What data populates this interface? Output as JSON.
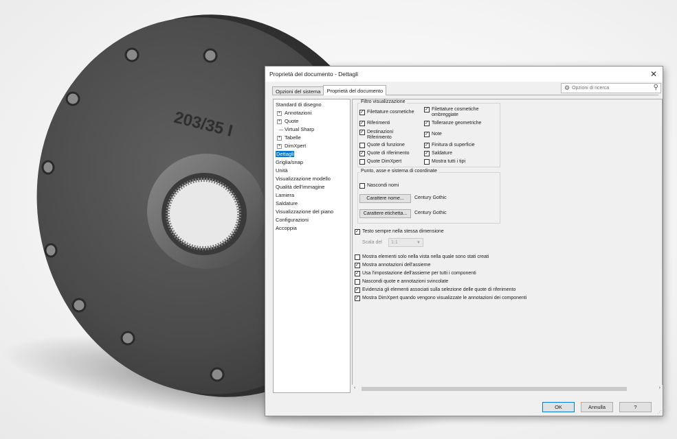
{
  "viewport": {
    "part_engraving": "203/35 I"
  },
  "dialog": {
    "title": "Proprietà del documento - Dettagli",
    "close_icon": "close-icon",
    "tabs": [
      {
        "label": "Opzioni del sistema",
        "active": false
      },
      {
        "label": "Proprietà del documento",
        "active": true
      }
    ],
    "search": {
      "placeholder": "Opzioni di ricerca",
      "icon": "search-icon",
      "settings_icon": "gear-icon"
    },
    "tree": [
      {
        "label": "Standard di disegno",
        "level": 0,
        "expandable": false,
        "selected": false
      },
      {
        "label": "Annotazioni",
        "level": 1,
        "expandable": true,
        "selected": false
      },
      {
        "label": "Quote",
        "level": 1,
        "expandable": true,
        "selected": false
      },
      {
        "label": "Virtual Sharp",
        "level": 1,
        "expandable": false,
        "selected": false
      },
      {
        "label": "Tabelle",
        "level": 1,
        "expandable": true,
        "selected": false
      },
      {
        "label": "DimXpert",
        "level": 1,
        "expandable": true,
        "selected": false
      },
      {
        "label": "Dettagli",
        "level": 0,
        "expandable": false,
        "selected": true
      },
      {
        "label": "Griglia/snap",
        "level": 0,
        "expandable": false,
        "selected": false
      },
      {
        "label": "Unità",
        "level": 0,
        "expandable": false,
        "selected": false
      },
      {
        "label": "Visualizzazione modello",
        "level": 0,
        "expandable": false,
        "selected": false
      },
      {
        "label": "Qualità dell'immagine",
        "level": 0,
        "expandable": false,
        "selected": false
      },
      {
        "label": "Lamiera",
        "level": 0,
        "expandable": false,
        "selected": false
      },
      {
        "label": "Saldature",
        "level": 0,
        "expandable": false,
        "selected": false
      },
      {
        "label": "Visualizzazione del piano",
        "level": 0,
        "expandable": false,
        "selected": false
      },
      {
        "label": "Configurazioni",
        "level": 0,
        "expandable": false,
        "selected": false
      },
      {
        "label": "Accoppia",
        "level": 0,
        "expandable": false,
        "selected": false
      }
    ],
    "filter_group": {
      "title": "Filtro visualizzazione",
      "left": [
        {
          "label": "Filettature cosmetiche",
          "checked": true
        },
        {
          "label": "Riferimenti",
          "checked": true
        },
        {
          "label": "Destinazioni\nRiferimento",
          "checked": true
        },
        {
          "label": "Quote di funzione",
          "checked": false
        },
        {
          "label": "Quote di riferimento",
          "checked": true
        },
        {
          "label": "Quote DimXpert",
          "checked": false
        }
      ],
      "right": [
        {
          "label": "Filettature cosmetiche\nombreggiate",
          "checked": true
        },
        {
          "label": "Tolleranze geometriche",
          "checked": true
        },
        {
          "label": "Note",
          "checked": true
        },
        {
          "label": "Finitura di superficie",
          "checked": true
        },
        {
          "label": "Saldature",
          "checked": true
        },
        {
          "label": "Mostra tutti i tipi",
          "checked": false
        }
      ]
    },
    "coord_group": {
      "title": "Punto, asse e sistema di coordinate",
      "hide_names": {
        "label": "Nascondi nomi",
        "checked": false
      },
      "name_font_button": "Carattere nome...",
      "name_font_value": "Century Gothic",
      "label_font_button": "Carattere etichetta...",
      "label_font_value": "Century Gothic"
    },
    "same_size": {
      "label": "Testo sempre nella stessa dimensione",
      "checked": true
    },
    "scale": {
      "label": "Scala del",
      "value": "1:1"
    },
    "options": [
      {
        "label": "Mostra elementi solo nella vista nella quale sono stati creati",
        "checked": false
      },
      {
        "label": "Mostra annotazioni dell'assieme",
        "checked": true
      },
      {
        "label": "Usa l'impostazione dell'assieme per tutti i componenti",
        "checked": true
      },
      {
        "label": "Nascondi quote e annotazioni svincolate",
        "checked": false
      },
      {
        "label": "Evidenzia gli elementi associati sulla selezione delle quote di riferimento",
        "checked": true
      },
      {
        "label": "Mostra DimXpert quando vengono visualizzate le annotazioni dei componenti",
        "checked": true
      }
    ],
    "buttons": {
      "ok": "OK",
      "cancel": "Annulla",
      "help": "?"
    }
  }
}
